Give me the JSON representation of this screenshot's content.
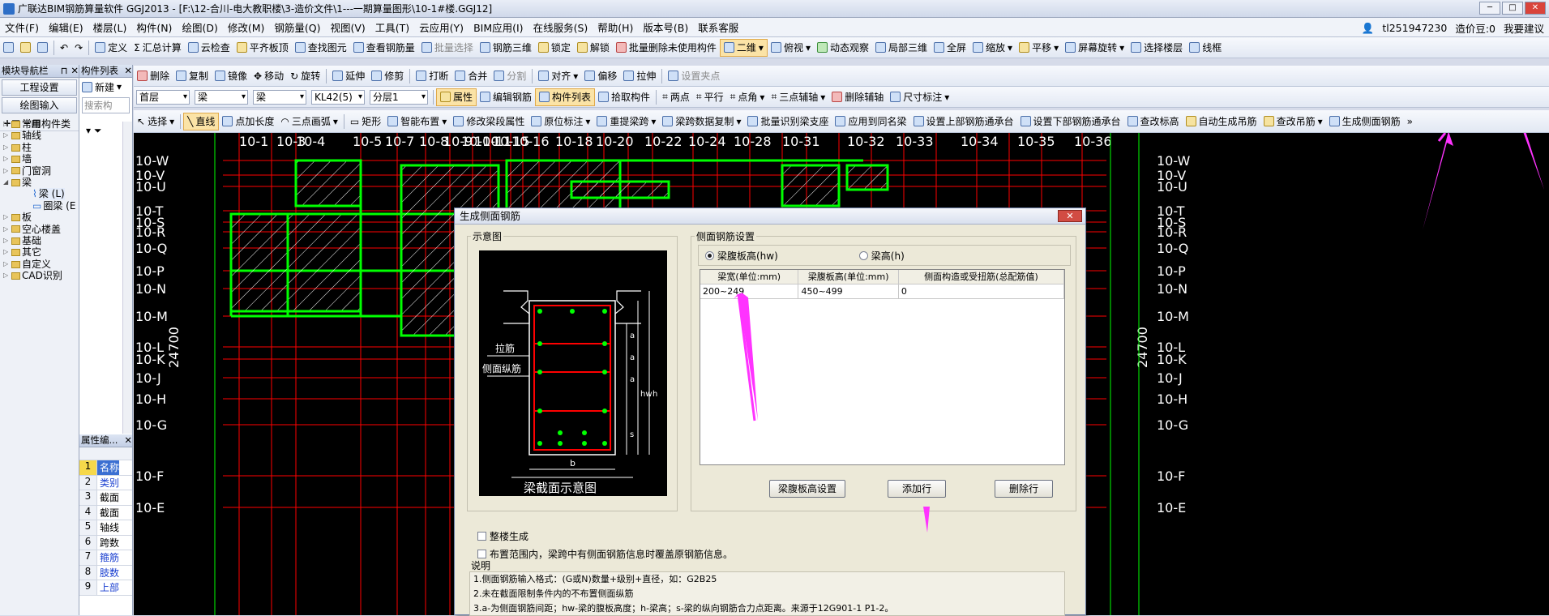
{
  "window": {
    "title": "广联达BIM钢筋算量软件 GGJ2013 - [F:\\12-合川-电大教职楼\\3-造价文件\\1---一期算量图形\\10-1#楼.GGJ12]"
  },
  "menu": {
    "items": [
      "文件(F)",
      "编辑(E)",
      "楼层(L)",
      "构件(N)",
      "绘图(D)",
      "修改(M)",
      "钢筋量(Q)",
      "视图(V)",
      "工具(T)",
      "云应用(Y)",
      "BIM应用(I)",
      "在线服务(S)",
      "帮助(H)",
      "版本号(B)",
      "联系客服"
    ],
    "user": "tl251947230",
    "coins": "造价豆:0",
    "help": "我要建议"
  },
  "toolbar1": [
    "定义",
    "汇总计算",
    "云检查",
    "平齐板顶",
    "查找图元",
    "查看钢筋量",
    "批量选择",
    "钢筋三维",
    "锁定",
    "解锁",
    "批量删除未使用构件",
    "二维",
    "俯视",
    "动态观察",
    "局部三维",
    "全屏",
    "缩放",
    "平移",
    "屏幕旋转",
    "选择楼层",
    "线框"
  ],
  "toolbar2": [
    "删除",
    "复制",
    "镜像",
    "移动",
    "旋转",
    "延伸",
    "修剪",
    "打断",
    "合并",
    "分割",
    "对齐",
    "偏移",
    "拉伸",
    "设置夹点"
  ],
  "toolbar3": {
    "selects": [
      "首层",
      "梁",
      "梁",
      "KL42(5)",
      "分层1"
    ],
    "buttons": [
      "属性",
      "编辑钢筋",
      "构件列表",
      "拾取构件",
      "两点",
      "平行",
      "点角",
      "三点辅轴",
      "删除辅轴",
      "尺寸标注"
    ]
  },
  "toolbar4": [
    "选择",
    "直线",
    "点加长度",
    "三点画弧",
    "矩形",
    "智能布置",
    "修改梁段属性",
    "原位标注",
    "重提梁跨",
    "梁跨数据复制",
    "批量识别梁支座",
    "应用到同名梁",
    "设置上部钢筋通承台",
    "设置下部钢筋通承台",
    "查改标高",
    "自动生成吊筋",
    "查改吊筋",
    "生成侧面钢筋"
  ],
  "left_panel": {
    "header_nav": "模块导航栏",
    "header_list": "构件列表",
    "btn_project": "工程设置",
    "btn_draw": "绘图输入",
    "btn_new": "新建",
    "search_placeholder": "搜索构",
    "tree": [
      "常用构件类",
      "轴线",
      "柱",
      "墙",
      "门窗洞",
      "梁",
      "梁 (L)",
      "圈梁 (E",
      "板",
      "空心楼盖",
      "基础",
      "其它",
      "自定义",
      "CAD识别"
    ]
  },
  "prop_panel": {
    "header": "属性编...",
    "rows": [
      {
        "n": "1",
        "v": "名称"
      },
      {
        "n": "2",
        "v": "类别"
      },
      {
        "n": "3",
        "v": "截面"
      },
      {
        "n": "4",
        "v": "截面"
      },
      {
        "n": "5",
        "v": "轴线"
      },
      {
        "n": "6",
        "v": "跨数"
      },
      {
        "n": "7",
        "v": "箍筋"
      },
      {
        "n": "8",
        "v": "肢数"
      },
      {
        "n": "9",
        "v": "上部"
      }
    ]
  },
  "cad": {
    "top_axes": [
      "10-1",
      "10-3",
      "10-4",
      "10-5",
      "10-7",
      "10-8",
      "10-9",
      "10-10",
      "10-11",
      "10-15",
      "10-16",
      "10-18",
      "10-20",
      "10-22",
      "10-24",
      "10-28",
      "10-31",
      "10-32",
      "10-33",
      "10-34",
      "10-35",
      "10-36"
    ],
    "side_axes": [
      "10-W",
      "10-V",
      "10-U",
      "10-T",
      "10-S",
      "10-R",
      "10-Q",
      "10-P",
      "10-N",
      "10-M",
      "10-L",
      "10-K",
      "10-J",
      "10-H",
      "10-G",
      "10-F",
      "10-E"
    ],
    "dim_total": "24700"
  },
  "dialog": {
    "title": "生成侧面钢筋",
    "schematic_label": "示意图",
    "settings_label": "侧面钢筋设置",
    "radio_web": "梁腹板高(hw)",
    "radio_height": "梁高(h)",
    "schem": {
      "tie": "拉筋",
      "side": "侧面纵筋",
      "caption": "梁截面示意图",
      "b": "b",
      "a": "a",
      "hw": "hw",
      "h": "h",
      "s": "s"
    },
    "table": {
      "headers": [
        "梁宽(单位:mm)",
        "梁腹板高(单位:mm)",
        "侧面构造或受扭筋(总配筋值)"
      ],
      "rows": [
        [
          "200~249",
          "450~499",
          "0"
        ]
      ]
    },
    "btn_set_web": "梁腹板高设置",
    "btn_add": "添加行",
    "btn_delete": "删除行",
    "chk_whole": "整楼生成",
    "chk_cover": "布置范围内，梁跨中有侧面钢筋信息时覆盖原钢筋信息。",
    "note_title": "说明",
    "notes": [
      "1.侧面钢筋输入格式：(G或N)数量+级别+直径，如：G2B25",
      "2.未在截面限制条件内的不布置侧面纵筋",
      "3.a-为侧面钢筋间距；hw-梁的腹板高度；h-梁高；s-梁的纵向钢筋合力点距离。来源于12G901-1 P1-2。"
    ]
  },
  "colors": {
    "grid_red": "#ff0000",
    "grid_green": "#00ff00",
    "beam_yellow": "#ffff00",
    "annotation": "#ff33ff"
  }
}
